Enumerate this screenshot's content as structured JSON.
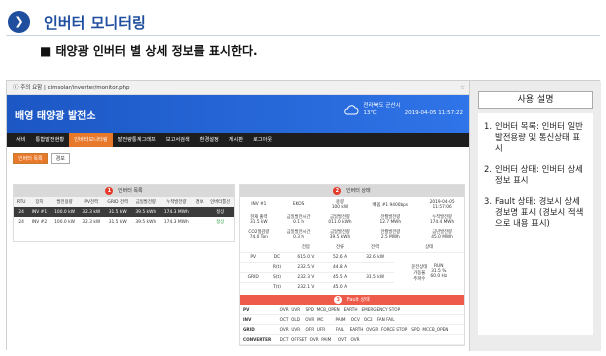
{
  "slide": {
    "icon": "❯",
    "title": "인버터 모니터링",
    "subtitle": "■ 태양광 인버터 별 상세 정보를 표시한다."
  },
  "browser": {
    "url": "ⓘ 주의 요함 | cimsolar/inverter/monitor.php",
    "star": "☆"
  },
  "app": {
    "name": "배영 태양광 발전소",
    "location": "전라북도 군산시",
    "weather": "13℃",
    "datetime": "2019-04-05 11:57:22",
    "nav": [
      "서비",
      "통합발전현황",
      "인버터모니터링",
      "발전량통계그래프",
      "보고서검색",
      "환경설정",
      "게시판",
      "로그아웃"
    ],
    "nav_active_index": 2,
    "tabs": [
      "인버터 목록",
      "경보"
    ]
  },
  "inverter_list": {
    "badge": "1",
    "title": "인버터 목록",
    "headers": [
      "RTU",
      "장치",
      "발전용량",
      "PV전력",
      "GRID 전력",
      "금일발전량",
      "누적발전량",
      "경보",
      "인버터통신"
    ],
    "rows": [
      [
        "24",
        "INV #1",
        "100.0 kW",
        "32.3 kW",
        "31.5 kW",
        "39.5 kWh",
        "174.3 MWh",
        "",
        "정상"
      ],
      [
        "24",
        "INV #2",
        "100.0 kW",
        "32.3 kW",
        "31.5 kW",
        "39.5 kWh",
        "174.3 MWh",
        "",
        "정상"
      ]
    ]
  },
  "inverter_detail": {
    "badge": "2",
    "title": "인버터 상태",
    "top": {
      "device": "INV #1",
      "model": "EKOS",
      "capacity_label": "용량",
      "capacity": "100 kW",
      "name": "배옵 #1 9400bps",
      "date": "2019-04-05",
      "time": "11:57:06"
    },
    "metrics_row1": [
      {
        "label": "현재 출력",
        "value": "31.5 kW"
      },
      {
        "label": "금일발전시간",
        "value": "0.1 h"
      },
      {
        "label": "금일발전량",
        "value": "011.0 kWh"
      },
      {
        "label": "전월발전량",
        "value": "12.7 MWh"
      },
      {
        "label": "누적발전량",
        "value": "174.4 MWh"
      }
    ],
    "metrics_row2": [
      {
        "label": "CO2절감량",
        "value": "74.0 Ton"
      },
      {
        "label": "금일발전시간",
        "value": "0.3 h"
      },
      {
        "label": "금일발전량",
        "value": "39.5 kWh"
      },
      {
        "label": "전월발전량",
        "value": "2.5 MWh"
      },
      {
        "label": "금년발전량",
        "value": "45.0 MWh"
      }
    ],
    "table_headers": [
      "",
      "",
      "전압",
      "전류",
      "전력",
      "상태"
    ],
    "rows": [
      [
        "PV",
        "DC",
        "615.0 V",
        "52.6 A",
        "32.6 kW"
      ],
      [
        "",
        "R(t)",
        "232.5 V",
        "44.8 A",
        ""
      ],
      [
        "GRID",
        "S(t)",
        "232.3 V",
        "45.5 A",
        "31.5 kW"
      ],
      [
        "",
        "T(t)",
        "232.1 V",
        "45.0 A",
        ""
      ]
    ],
    "status_label": "운전상태\n가동율\n주파수",
    "status_value": "RUN\n31.5 %\n60.0 Hz"
  },
  "fault_status": {
    "badge": "3",
    "title": "Fault 상태",
    "rows": [
      {
        "k": "PV",
        "v": "OVR  UVR    SPD  MCB_OPEN   EARTH   EMERGENCY STOP"
      },
      {
        "k": "INV",
        "v": "OCT  OLD    OVR  MC         PAIM    OCV   OC2   FAN FAIL"
      },
      {
        "k": "GRID",
        "v": "OVR  UVR    OFR  UFR        FAIL    EARTH  OVGR  FORCE STOP   SPD  MCCB_OPEN"
      },
      {
        "k": "CONVERTER",
        "v": "DCT  OFFSET  OVR  PAIM     OVT   OVR"
      }
    ]
  },
  "usage": {
    "title": "사용 설명",
    "items": [
      {
        "num": "1.",
        "text": "인버터 목록: 인버터 일반 발전용량 및 통신상태 표시"
      },
      {
        "num": "2.",
        "text": "인버터 상태: 인버터 상세 정보 표시"
      },
      {
        "num": "3.",
        "text": "Fault 상태: 경보시 상세 경보명 표시 (경보시 적색으로 내용 표시)"
      }
    ]
  },
  "colors": {
    "accent_blue": "#1f4e9e",
    "app_header": "#2f74e8",
    "nav_active": "#e8782a",
    "fault_red": "#ef5b4a",
    "status_ok": "#2a9d3a"
  }
}
